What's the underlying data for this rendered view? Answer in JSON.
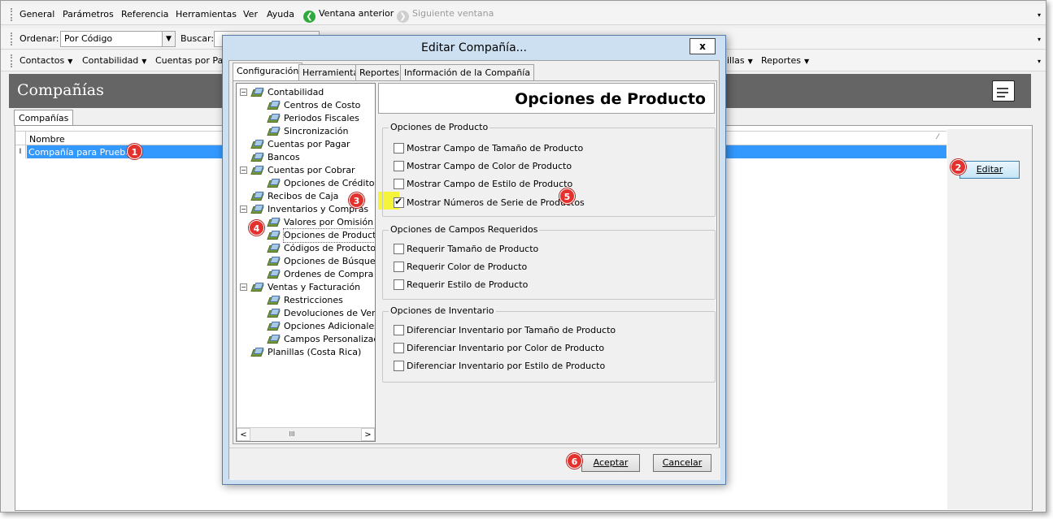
{
  "menu": {
    "items": [
      "General",
      "Parámetros",
      "Referencia",
      "Herramientas",
      "Ver",
      "Ayuda"
    ],
    "back_label": "Ventana anterior",
    "next_label": "Siguiente ventana"
  },
  "toolbar2": {
    "order_label": "Ordenar:",
    "order_value": "Por Código",
    "search_label": "Buscar:"
  },
  "toolbar3": {
    "items": [
      "Contactos",
      "Contabilidad",
      "Cuentas por Pag"
    ],
    "right_items": [
      "illas",
      "Reportes"
    ]
  },
  "header": {
    "title": "Compañías"
  },
  "subtab": {
    "label": "Compañías"
  },
  "grid": {
    "column": "Nombre",
    "rows": [
      {
        "marker": "I",
        "name": "Compañía para Pruebas"
      }
    ]
  },
  "side": {
    "edit_label": "Editar"
  },
  "badges": [
    "1",
    "2",
    "3",
    "4",
    "5",
    "6"
  ],
  "dialog": {
    "title": "Editar Compañía...",
    "close": "x",
    "tabs": [
      "Configuración",
      "Herramientas",
      "Reportes",
      "Información de la Compañía"
    ],
    "tree": [
      {
        "label": "Contabilidad",
        "level": 0,
        "exp": "⊟"
      },
      {
        "label": "Centros de Costo",
        "level": 1
      },
      {
        "label": "Periodos Fiscales",
        "level": 1
      },
      {
        "label": "Sincronización",
        "level": 1
      },
      {
        "label": "Cuentas por Pagar",
        "level": 0
      },
      {
        "label": "Bancos",
        "level": 0
      },
      {
        "label": "Cuentas por Cobrar",
        "level": 0,
        "exp": "⊟"
      },
      {
        "label": "Opciones de Crédito",
        "level": 1
      },
      {
        "label": "Recibos de Caja",
        "level": 0
      },
      {
        "label": "Inventarios y Compras",
        "level": 0,
        "exp": "⊟"
      },
      {
        "label": "Valores por Omisión",
        "level": 1
      },
      {
        "label": "Opciones de Producto",
        "level": 1,
        "selected": true
      },
      {
        "label": "Códigos de Producto",
        "level": 1
      },
      {
        "label": "Opciones de Búsqueda",
        "level": 1
      },
      {
        "label": "Ordenes de Compra",
        "level": 1
      },
      {
        "label": "Ventas y Facturación",
        "level": 0,
        "exp": "⊟"
      },
      {
        "label": "Restricciones",
        "level": 1
      },
      {
        "label": "Devoluciones de Venta",
        "level": 1
      },
      {
        "label": "Opciones Adicionales",
        "level": 1
      },
      {
        "label": "Campos Personalizados",
        "level": 1
      },
      {
        "label": "Planillas (Costa Rica)",
        "level": 0
      }
    ],
    "scroll_thumb": "III",
    "panel_title": "Opciones de Producto",
    "groups": [
      {
        "label": "Opciones de Producto",
        "options": [
          {
            "text": "Mostrar Campo de Tamaño de Producto",
            "checked": false
          },
          {
            "text": "Mostrar Campo de Color de Producto",
            "checked": false
          },
          {
            "text": "Mostrar Campo de Estilo de Producto",
            "checked": false
          },
          {
            "text": "Mostrar Números de Serie de Productos",
            "checked": true
          }
        ]
      },
      {
        "label": "Opciones de Campos Requeridos",
        "options": [
          {
            "text": "Requerir Tamaño de Producto",
            "checked": false
          },
          {
            "text": "Requerir Color de Producto",
            "checked": false
          },
          {
            "text": "Requerir Estilo de Producto",
            "checked": false
          }
        ]
      },
      {
        "label": "Opciones de Inventario",
        "options": [
          {
            "text": "Diferenciar Inventario por Tamaño de Producto",
            "checked": false
          },
          {
            "text": "Diferenciar Inventario por Color de Producto",
            "checked": false
          },
          {
            "text": "Diferenciar Inventario por Estilo de Producto",
            "checked": false
          }
        ]
      }
    ],
    "accept_label": "Aceptar",
    "cancel_label": "Cancelar"
  }
}
